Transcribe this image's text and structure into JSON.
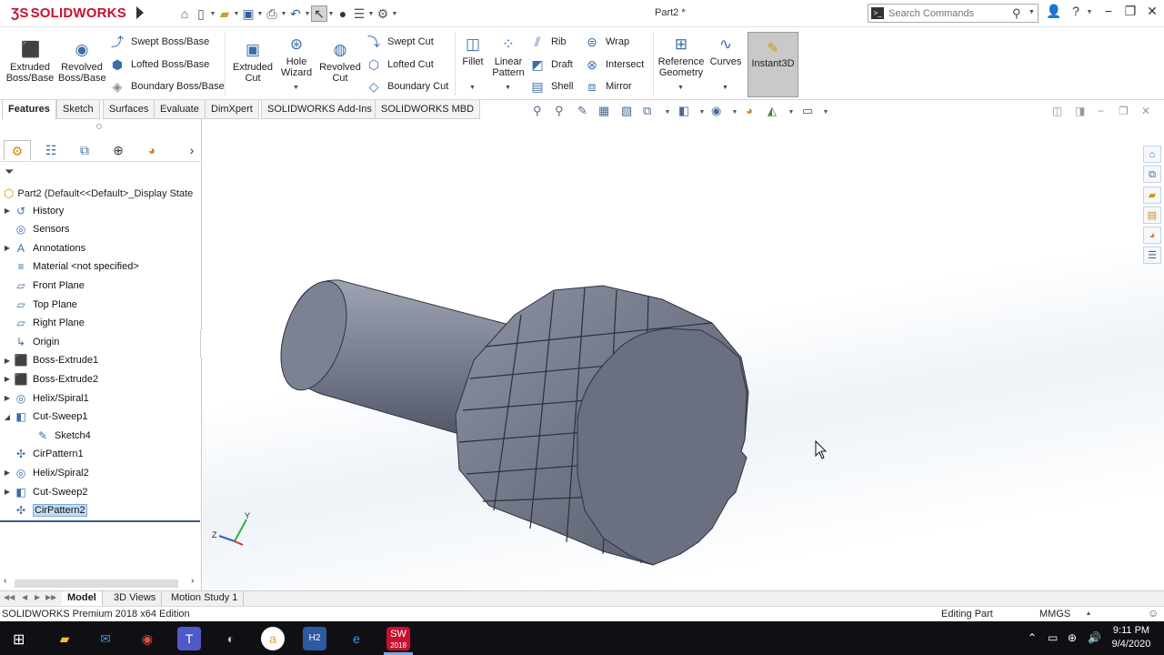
{
  "app": {
    "logo_ds": "ƷS",
    "logo_text": "SOLIDWORKS",
    "document_title": "Part2 *"
  },
  "search": {
    "placeholder": "Search Commands"
  },
  "ribbon": {
    "extruded_boss": "Extruded Boss/Base",
    "revolved_boss": "Revolved Boss/Base",
    "swept_boss": "Swept Boss/Base",
    "lofted_boss": "Lofted Boss/Base",
    "boundary_boss": "Boundary Boss/Base",
    "extruded_cut": "Extruded Cut",
    "hole_wizard": "Hole Wizard",
    "revolved_cut": "Revolved Cut",
    "swept_cut": "Swept Cut",
    "lofted_cut": "Lofted Cut",
    "boundary_cut": "Boundary Cut",
    "fillet": "Fillet",
    "linear_pattern": "Linear Pattern",
    "rib": "Rib",
    "draft": "Draft",
    "shell": "Shell",
    "wrap": "Wrap",
    "intersect": "Intersect",
    "mirror": "Mirror",
    "reference_geometry": "Reference Geometry",
    "curves": "Curves",
    "instant3d": "Instant3D"
  },
  "command_tabs": [
    "Features",
    "Sketch",
    "Surfaces",
    "Evaluate",
    "DimXpert",
    "SOLIDWORKS Add-Ins",
    "SOLIDWORKS MBD"
  ],
  "tree": {
    "root": "Part2  (Default<<Default>_Display State",
    "items": [
      {
        "label": "History",
        "icon": "history-icon",
        "expandable": true
      },
      {
        "label": "Sensors",
        "icon": "sensor-icon",
        "expandable": false
      },
      {
        "label": "Annotations",
        "icon": "annotation-icon",
        "expandable": true
      },
      {
        "label": "Material <not specified>",
        "icon": "material-icon",
        "expandable": false
      },
      {
        "label": "Front Plane",
        "icon": "plane-icon",
        "expandable": false
      },
      {
        "label": "Top Plane",
        "icon": "plane-icon",
        "expandable": false
      },
      {
        "label": "Right Plane",
        "icon": "plane-icon",
        "expandable": false
      },
      {
        "label": "Origin",
        "icon": "origin-icon",
        "expandable": false
      },
      {
        "label": "Boss-Extrude1",
        "icon": "extrude-icon",
        "expandable": true
      },
      {
        "label": "Boss-Extrude2",
        "icon": "extrude-icon",
        "expandable": true
      },
      {
        "label": "Helix/Spiral1",
        "icon": "helix-icon",
        "expandable": true
      },
      {
        "label": "Cut-Sweep1",
        "icon": "cut-sweep-icon",
        "expandable": true,
        "expanded": true
      },
      {
        "label": "Sketch4",
        "icon": "sketch-icon",
        "expandable": false,
        "child": true
      },
      {
        "label": "CirPattern1",
        "icon": "circular-pattern-icon",
        "expandable": false
      },
      {
        "label": "Helix/Spiral2",
        "icon": "helix-icon",
        "expandable": true
      },
      {
        "label": "Cut-Sweep2",
        "icon": "cut-sweep-icon",
        "expandable": true
      },
      {
        "label": "CirPattern2",
        "icon": "circular-pattern-icon",
        "expandable": false,
        "selected": true
      }
    ]
  },
  "triad": {
    "x": "Z",
    "y": "Y"
  },
  "bottom_tabs": [
    "Model",
    "3D Views",
    "Motion Study 1"
  ],
  "status": {
    "edition": "SOLIDWORKS Premium 2018 x64 Edition",
    "mode": "Editing Part",
    "units": "MMGS"
  },
  "taskbar": {
    "time": "9:11 PM",
    "date": "9/4/2020",
    "sw_badge": "2018"
  },
  "colors": {
    "accent_red": "#c8102e",
    "model_gray": "#6b7080",
    "selection": "#c5dcf5"
  }
}
